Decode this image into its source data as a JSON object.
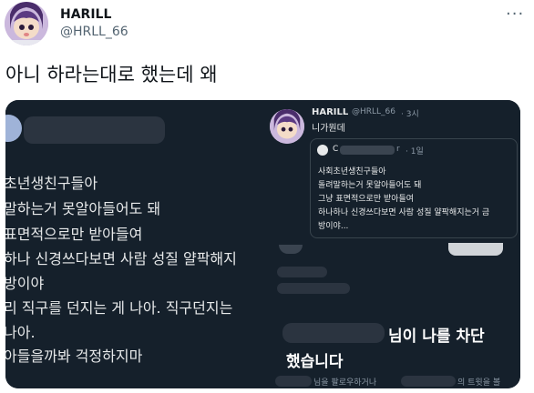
{
  "author": {
    "name": "HARILL",
    "handle": "@HRLL_66"
  },
  "more_icon": "···",
  "tweet_text": "아니 하라는대로 했는데 왜",
  "left_image": {
    "lines": [
      "초년생친구들아",
      "말하는거 못알아들어도 돼",
      " 표면적으로만 받아들여",
      "하나 신경쓰다보면 사람 성질 얄팍해지",
      " 방이야",
      "리 직구를 던지는 게 나아. 직구던지는",
      " 나아.",
      "아들을까봐 걱정하지마"
    ]
  },
  "reply_card": {
    "name": "HARILL",
    "handle": "@HRLL_66",
    "time": "· 3시",
    "text": "니가뭔데",
    "quoted": {
      "name_initial": "C",
      "suffix": "r",
      "time": "· 1일",
      "lines": [
        "사회초년생친구들아",
        "돌려말하는거 못알아들어도 돼",
        "그냥 표면적으로만 받아들여",
        "하나하나 신경쓰다보면 사람 성질 얄팍해지는거 금",
        "방이야..."
      ]
    }
  },
  "block_notice": {
    "line1": "님이 나를 차단",
    "line2": "했습니다",
    "sub": "님을 팔로우하거나",
    "sub2": "의 트윗을 볼"
  },
  "colors": {
    "bg_dark": "#15202b",
    "text_light": "#e7e9ea",
    "muted": "#536471"
  }
}
